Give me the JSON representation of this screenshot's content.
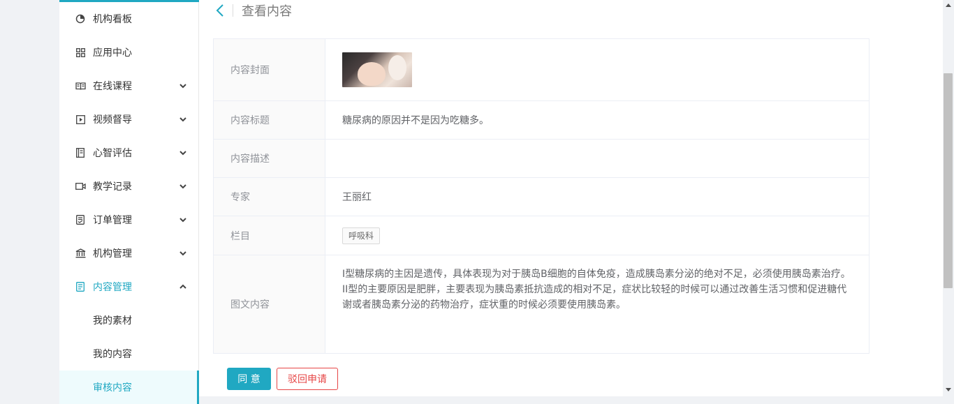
{
  "sidebar": {
    "items": [
      {
        "label": "机构看板",
        "icon": "pie-chart-icon",
        "expandable": false
      },
      {
        "label": "应用中心",
        "icon": "grid-icon",
        "expandable": true
      },
      {
        "label": "在线课程",
        "icon": "open-book-icon",
        "expandable": true
      },
      {
        "label": "视频督导",
        "icon": "play-square-icon",
        "expandable": true
      },
      {
        "label": "心智评估",
        "icon": "notebook-icon",
        "expandable": true
      },
      {
        "label": "教学记录",
        "icon": "video-camera-icon",
        "expandable": true
      },
      {
        "label": "订单管理",
        "icon": "order-list-icon",
        "expandable": true
      },
      {
        "label": "机构管理",
        "icon": "bank-icon",
        "expandable": true
      },
      {
        "label": "内容管理",
        "icon": "document-icon",
        "expandable": true,
        "expanded": true
      }
    ],
    "content_submenu": [
      {
        "label": "我的素材"
      },
      {
        "label": "我的内容"
      },
      {
        "label": "审核内容",
        "selected": true
      }
    ]
  },
  "header": {
    "title": "查看内容"
  },
  "details": {
    "cover_label": "内容封面",
    "title_label": "内容标题",
    "title_value": "糖尿病的原因并不是因为吃糖多。",
    "desc_label": "内容描述",
    "desc_value": "",
    "expert_label": "专家",
    "expert_value": "王丽红",
    "column_label": "栏目",
    "column_tag": "呼吸科",
    "body_label": "图文内容",
    "body_lines": [
      "I型糖尿病的主因是遗传，具体表现为对于胰岛B细胞的自体免疫，造成胰岛素分泌的绝对不足，必须使用胰岛素治疗。",
      "II型的主要原因是肥胖，主要表现为胰岛素抵抗造成的相对不足，症状比较轻的时候可以通过改善生活习惯和促进糖代",
      "谢或者胰岛素分泌的药物治疗，症状重的时候必须要使用胰岛素。"
    ]
  },
  "actions": {
    "agree": "同 意",
    "reject": "驳回申请"
  },
  "colors": {
    "accent": "#20a8c2",
    "danger": "#e64545"
  }
}
